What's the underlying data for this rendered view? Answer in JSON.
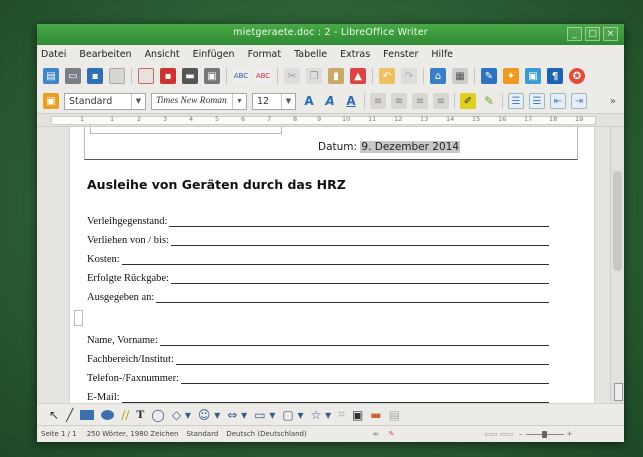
{
  "window": {
    "title": "mietgeraete.doc : 2 - LibreOffice Writer",
    "buttons": [
      "_",
      "□",
      "×"
    ]
  },
  "menu": [
    "Datei",
    "Bearbeiten",
    "Ansicht",
    "Einfügen",
    "Format",
    "Tabelle",
    "Extras",
    "Fenster",
    "Hilfe"
  ],
  "toolbar": {
    "paragraph_style": "Standard",
    "font_name": "Times New Roman",
    "font_size": "12",
    "overflow": "»",
    "icons": [
      "new-doc-icon",
      "open-icon",
      "save-icon",
      "email-icon",
      "edit-doc-icon",
      "export-pdf-icon",
      "print-icon",
      "print-preview-icon",
      "spellcheck-icon",
      "auto-spellcheck-icon",
      "cut-icon",
      "copy-icon",
      "paste-icon",
      "clone-formatting-icon",
      "undo-icon",
      "redo-icon",
      "hyperlink-icon",
      "table-icon",
      "draw-functions-icon",
      "navigator-icon",
      "gallery-icon",
      "formatting-marks-icon",
      "help-icon"
    ]
  },
  "ruler": {
    "numbers": [
      "1",
      "1",
      "2",
      "3",
      "4",
      "5",
      "6",
      "7",
      "8",
      "9",
      "10",
      "11",
      "12",
      "13",
      "14",
      "15",
      "16",
      "17",
      "18",
      "19"
    ]
  },
  "document": {
    "date_label": "Datum:",
    "date_value": "9. Dezember 2014",
    "heading": "Ausleihe von Geräten durch das HRZ",
    "fields_group1": [
      "Verleihgegenstand:",
      "Verliehen von / bis:",
      "Kosten:",
      "Erfolgte Rückgabe:",
      "Ausgegeben an:"
    ],
    "fields_group2": [
      "Name, Vorname:",
      "Fachbereich/Institut:",
      "Telefon-/Faxnummer:",
      "E-Mail:"
    ]
  },
  "statusbar": {
    "page": "Seite 1 / 1",
    "words": "250 Wörter, 1980 Zeichen",
    "page_style": "Standard",
    "language": "Deutsch (Deutschland)"
  },
  "colors": {
    "titlebar": "#3b9b3c",
    "desktop": "#2c6135",
    "highlight": "#c8c8c8"
  }
}
